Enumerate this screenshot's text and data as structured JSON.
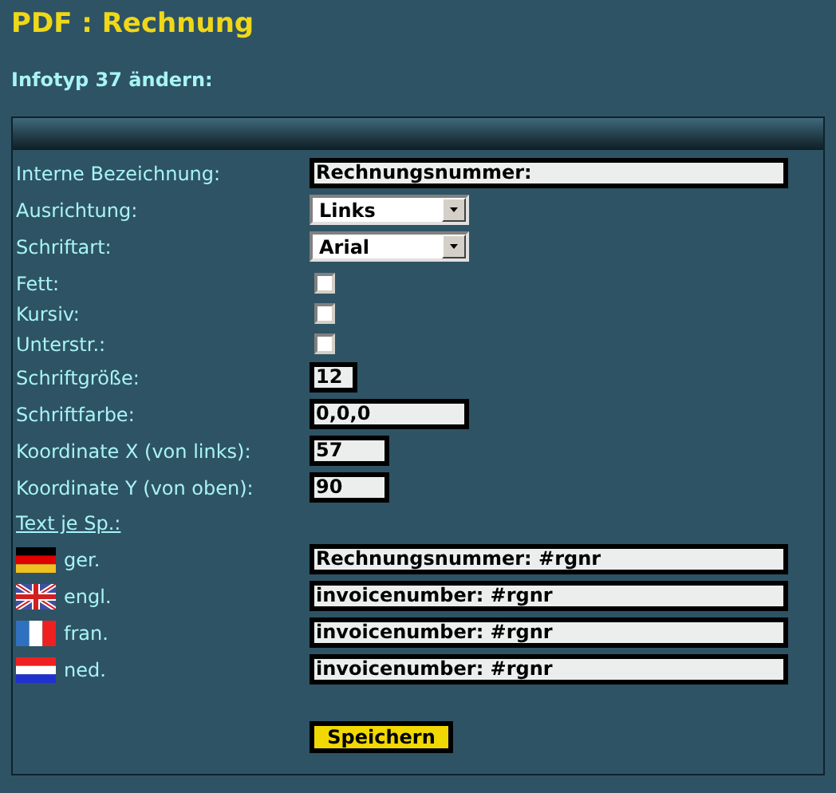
{
  "title": "PDF : Rechnung",
  "subtitle": "Infotyp 37 ändern:",
  "fields": [
    {
      "kind": "text",
      "label": "Interne Bezeichnung:",
      "value": "Rechnungsnummer:"
    },
    {
      "kind": "select",
      "label": "Ausrichtung:",
      "value": "Links"
    },
    {
      "kind": "select",
      "label": "Schriftart:",
      "value": "Arial"
    },
    {
      "kind": "checkbox",
      "label": "Fett:",
      "checked": false
    },
    {
      "kind": "checkbox",
      "label": "Kursiv:",
      "checked": false
    },
    {
      "kind": "checkbox",
      "label": "Unterstr.:",
      "checked": false
    },
    {
      "kind": "number",
      "label": "Schriftgröße:",
      "value": "12"
    },
    {
      "kind": "color",
      "label": "Schriftfarbe:",
      "value": "0,0,0"
    },
    {
      "kind": "coordinate",
      "label": "Koordinate X (von links):",
      "value": "57"
    },
    {
      "kind": "coordinate",
      "label": "Koordinate Y (von oben):",
      "value": "90"
    }
  ],
  "languages_link": "Text je Sp.:",
  "languages": [
    {
      "kind": "de",
      "label": "ger.",
      "value": "Rechnungsnummer: #rgnr"
    },
    {
      "kind": "gb",
      "label": "engl.",
      "value": "invoicenumber: #rgnr"
    },
    {
      "kind": "fr",
      "label": "fran.",
      "value": "invoicenumber: #rgnr"
    },
    {
      "kind": "nl",
      "label": "ned.",
      "value": "invoicenumber: #rgnr"
    }
  ],
  "save_button": "Speichern"
}
